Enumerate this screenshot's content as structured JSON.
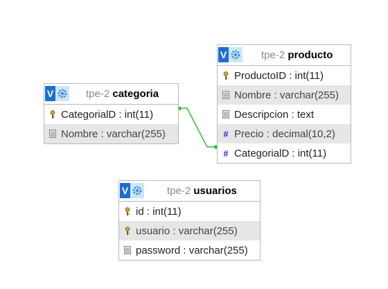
{
  "tables": {
    "categoria": {
      "db": "tpe-2",
      "name": "categoria",
      "columns": [
        {
          "text": "CategorialD : int(11)",
          "icon": "key-icon"
        },
        {
          "text": "Nombre : varchar(255)",
          "icon": "column-icon"
        }
      ]
    },
    "producto": {
      "db": "tpe-2",
      "name": "producto",
      "columns": [
        {
          "text": "ProductoID : int(11)",
          "icon": "key-icon"
        },
        {
          "text": "Nombre : varchar(255)",
          "icon": "column-icon"
        },
        {
          "text": "Descripcion : text",
          "icon": "column-icon"
        },
        {
          "text": "Precio : decimal(10,2)",
          "icon": "hash-icon"
        },
        {
          "text": "CategorialD : int(11)",
          "icon": "hash-icon"
        }
      ]
    },
    "usuarios": {
      "db": "tpe-2",
      "name": "usuarios",
      "columns": [
        {
          "text": "id : int(11)",
          "icon": "key-icon"
        },
        {
          "text": "usuario : varchar(255)",
          "icon": "key-icon"
        },
        {
          "text": "password : varchar(255)",
          "icon": "column-icon"
        }
      ]
    }
  },
  "colors": {
    "relation_line": "#2fbf2f",
    "header_v": "#1c6fd1",
    "header_gear_bg": "#cde6f8",
    "shaded_row": "#e6e6e6",
    "hash": "#2b32c9"
  }
}
